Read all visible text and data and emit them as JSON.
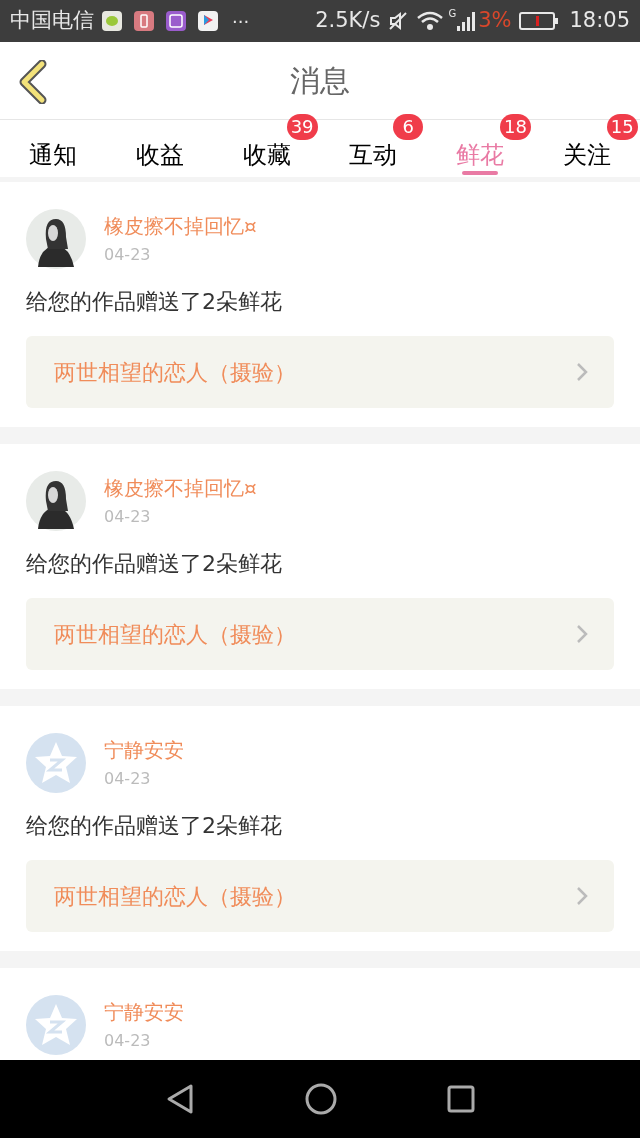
{
  "status_bar": {
    "carrier": "中国电信",
    "more": "···",
    "speed": "2.5K/s",
    "network": "G",
    "battery": "3%",
    "time": "18:05"
  },
  "header": {
    "title": "消息"
  },
  "tabs": [
    {
      "label": "通知",
      "selected": false
    },
    {
      "label": "收益",
      "selected": false
    },
    {
      "label": "收藏",
      "selected": false,
      "badge": "39"
    },
    {
      "label": "互动",
      "selected": false,
      "badge": "6"
    },
    {
      "label": "鲜花",
      "selected": true,
      "badge": "18"
    },
    {
      "label": "关注",
      "selected": false,
      "badge": "15"
    }
  ],
  "messages": [
    {
      "name": "橡皮擦不掉回忆¤",
      "date": "04-23",
      "text": "给您的作品赠送了2朵鲜花",
      "work": "两世相望的恋人（摄验）"
    },
    {
      "name": "橡皮擦不掉回忆¤",
      "date": "04-23",
      "text": "给您的作品赠送了2朵鲜花",
      "work": "两世相望的恋人（摄验）"
    },
    {
      "kind": "default",
      "name": "宁静安安",
      "date": "04-23",
      "text": "给您的作品赠送了2朵鲜花",
      "work": "两世相望的恋人（摄验）"
    },
    {
      "kind": "default",
      "name": "宁静安安",
      "date": "04-23"
    }
  ]
}
